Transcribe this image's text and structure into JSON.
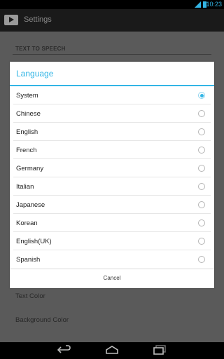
{
  "status_bar": {
    "time": "10:23",
    "network": "3G"
  },
  "action_bar": {
    "title": "Settings",
    "app_icon": "video-play-icon"
  },
  "settings": {
    "section_header": "TEXT TO SPEECH",
    "items": [
      "Text Color",
      "Background Color"
    ]
  },
  "dialog": {
    "title": "Language",
    "options": [
      {
        "label": "System",
        "selected": true
      },
      {
        "label": "Chinese",
        "selected": false
      },
      {
        "label": "English",
        "selected": false
      },
      {
        "label": "French",
        "selected": false
      },
      {
        "label": "Germany",
        "selected": false
      },
      {
        "label": "Italian",
        "selected": false
      },
      {
        "label": "Japanese",
        "selected": false
      },
      {
        "label": "Korean",
        "selected": false
      },
      {
        "label": "English(UK)",
        "selected": false
      },
      {
        "label": "Spanish",
        "selected": false
      }
    ],
    "cancel_label": "Cancel"
  },
  "nav_bar": {
    "icons": [
      "back-icon",
      "home-icon",
      "recent-apps-icon"
    ]
  },
  "colors": {
    "accent": "#33b5e5",
    "dim_background": "#5a5a5a"
  }
}
